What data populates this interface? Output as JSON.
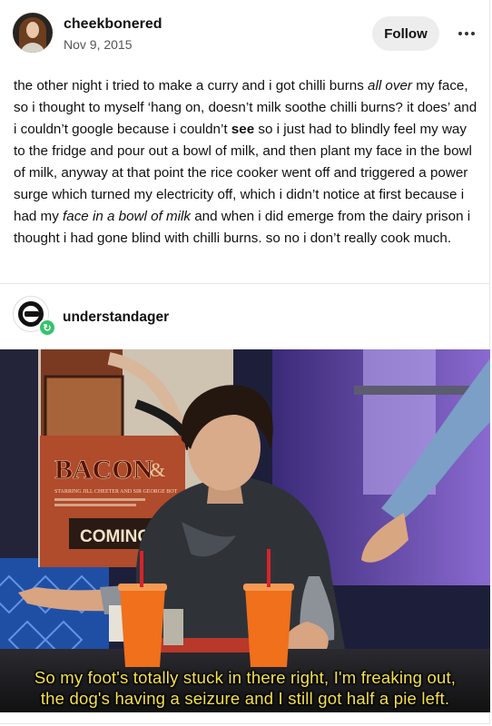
{
  "post": {
    "username": "cheekbonered",
    "date": "Nov 9, 2015",
    "follow_label": "Follow",
    "body": {
      "p1": "the other night i tried to make a curry and i got chilli burns ",
      "em1": "all over",
      "p2": " my face, so i thought to myself ‘hang on, doesn’t milk soothe chilli burns? it does’ and i couldn’t google because i couldn’t ",
      "strong1": "see",
      "p3": " so i just had to blindly feel my way to the fridge and pour out a bowl of milk, and then plant my face in the bowl of milk, anyway at that point the rice cooker went off and triggered a power surge which turned my electricity off, which i didn’t notice at first because i had my ",
      "em2": "face in a bowl of milk",
      "p4": " and when i did emerge from the dairy prison i thought i had gone blind with chilli burns. so no i don’t really cook much."
    }
  },
  "reblog": {
    "username": "understandager"
  },
  "media": {
    "poster_title": "BACON",
    "poster_sub": "STARRING JILL CHEETER AND SIR GEORGE BOT",
    "poster_coming": "COMING S",
    "subtitle_line1": "So my foot's totally stuck in there right, I'm freaking out,",
    "subtitle_line2": "the dog's having a seizure and I still got half a pie left."
  },
  "colors": {
    "accent_green": "#36c26b",
    "subtitle_yellow": "#f3e04a",
    "cup_orange": "#f0701c"
  }
}
